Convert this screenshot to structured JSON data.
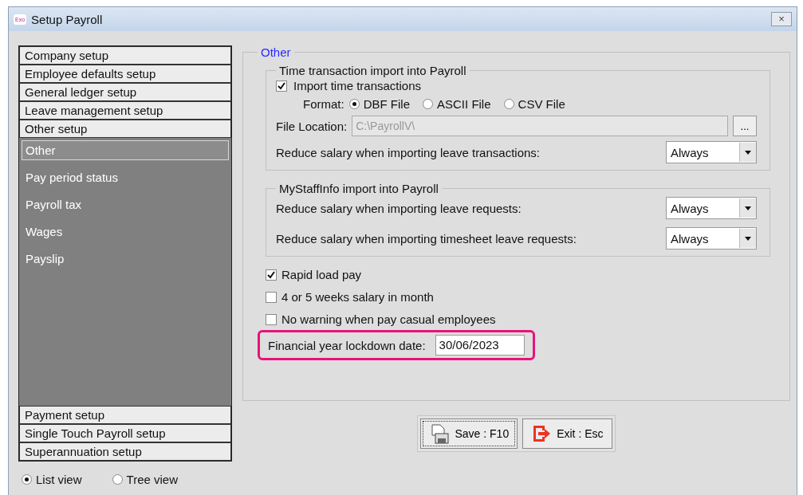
{
  "window": {
    "title": "Setup Payroll",
    "app_badge": "Exo",
    "close": "×"
  },
  "sections_top": [
    {
      "label": "Company setup"
    },
    {
      "label": "Employee defaults setup"
    },
    {
      "label": "General ledger setup"
    },
    {
      "label": "Leave management setup"
    },
    {
      "label": "Other setup"
    }
  ],
  "sub_items": [
    {
      "label": "Other",
      "selected": true
    },
    {
      "label": "Pay period status",
      "selected": false
    },
    {
      "label": "Payroll tax",
      "selected": false
    },
    {
      "label": "Wages",
      "selected": false
    },
    {
      "label": "Payslip",
      "selected": false
    }
  ],
  "sections_bottom": [
    {
      "label": "Payment setup"
    },
    {
      "label": "Single Touch Payroll setup"
    },
    {
      "label": "Superannuation setup"
    }
  ],
  "view_options": [
    {
      "label": "List view",
      "selected": true
    },
    {
      "label": "Tree view",
      "selected": false
    }
  ],
  "panel": {
    "title": "Other",
    "time_group": {
      "title": "Time transaction import into Payroll",
      "import_checkbox": {
        "label": "Import time transactions",
        "checked": true
      },
      "format_label": "Format:",
      "formats": [
        {
          "label": "DBF File",
          "selected": true
        },
        {
          "label": "ASCII File",
          "selected": false
        },
        {
          "label": "CSV File",
          "selected": false
        }
      ],
      "file_location": {
        "label": "File Location:",
        "value": "C:\\PayrollV\\",
        "disabled": true,
        "browse": "..."
      },
      "reduce": {
        "label": "Reduce salary when importing leave transactions:",
        "value": "Always"
      }
    },
    "mystaff_group": {
      "title": "MyStaffInfo import into Payroll",
      "rows": [
        {
          "label": "Reduce salary when importing leave requests:",
          "value": "Always"
        },
        {
          "label": "Reduce salary when importing timesheet leave requests:",
          "value": "Always"
        }
      ]
    },
    "options": [
      {
        "label": "Rapid load pay",
        "checked": true
      },
      {
        "label": "4 or 5 weeks salary in month",
        "checked": false
      },
      {
        "label": "No warning when pay casual employees",
        "checked": false
      }
    ],
    "lockdown": {
      "label": "Financial year lockdown date:",
      "value": "30/06/2023",
      "highlighted": true
    }
  },
  "buttons": [
    {
      "kind": "save",
      "label": "Save : F10"
    },
    {
      "kind": "exit",
      "label": "Exit : Esc"
    }
  ]
}
